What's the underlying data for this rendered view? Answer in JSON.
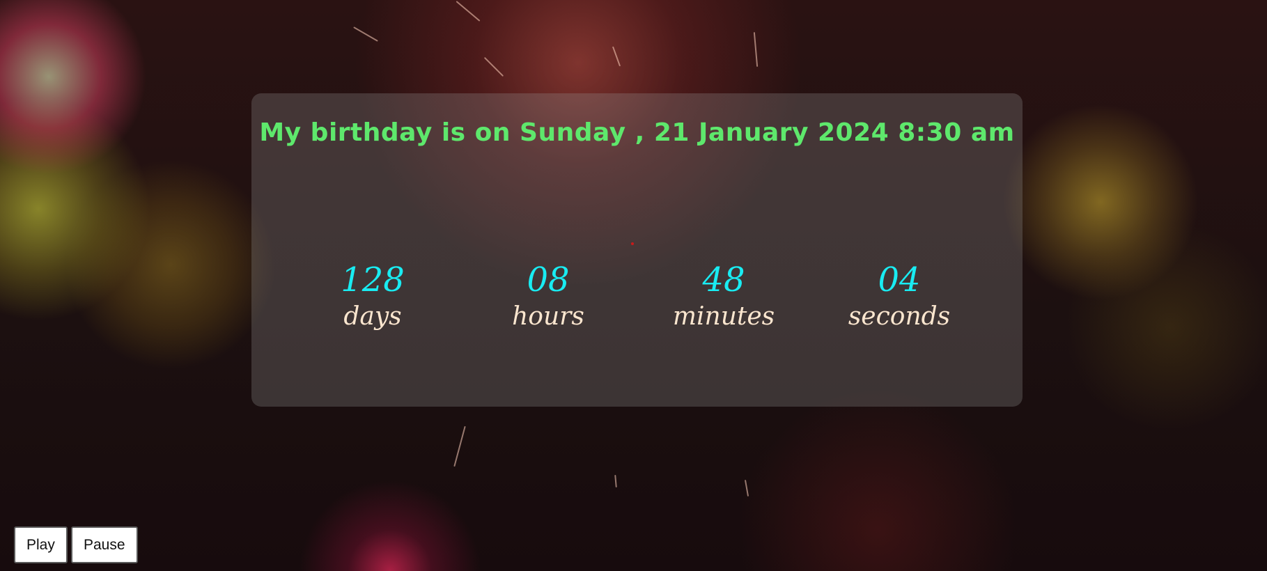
{
  "heading": "My birthday is on Sunday , 21 January 2024 8:30 am",
  "countdown": [
    {
      "value": "128",
      "label": "days"
    },
    {
      "value": "08",
      "label": "hours"
    },
    {
      "value": "48",
      "label": "minutes"
    },
    {
      "value": "04",
      "label": "seconds"
    }
  ],
  "controls": {
    "play_label": "Play",
    "pause_label": "Pause"
  },
  "colors": {
    "heading": "#5ee86c",
    "number": "#19ecf2",
    "unit_label": "#fbe6cf"
  }
}
